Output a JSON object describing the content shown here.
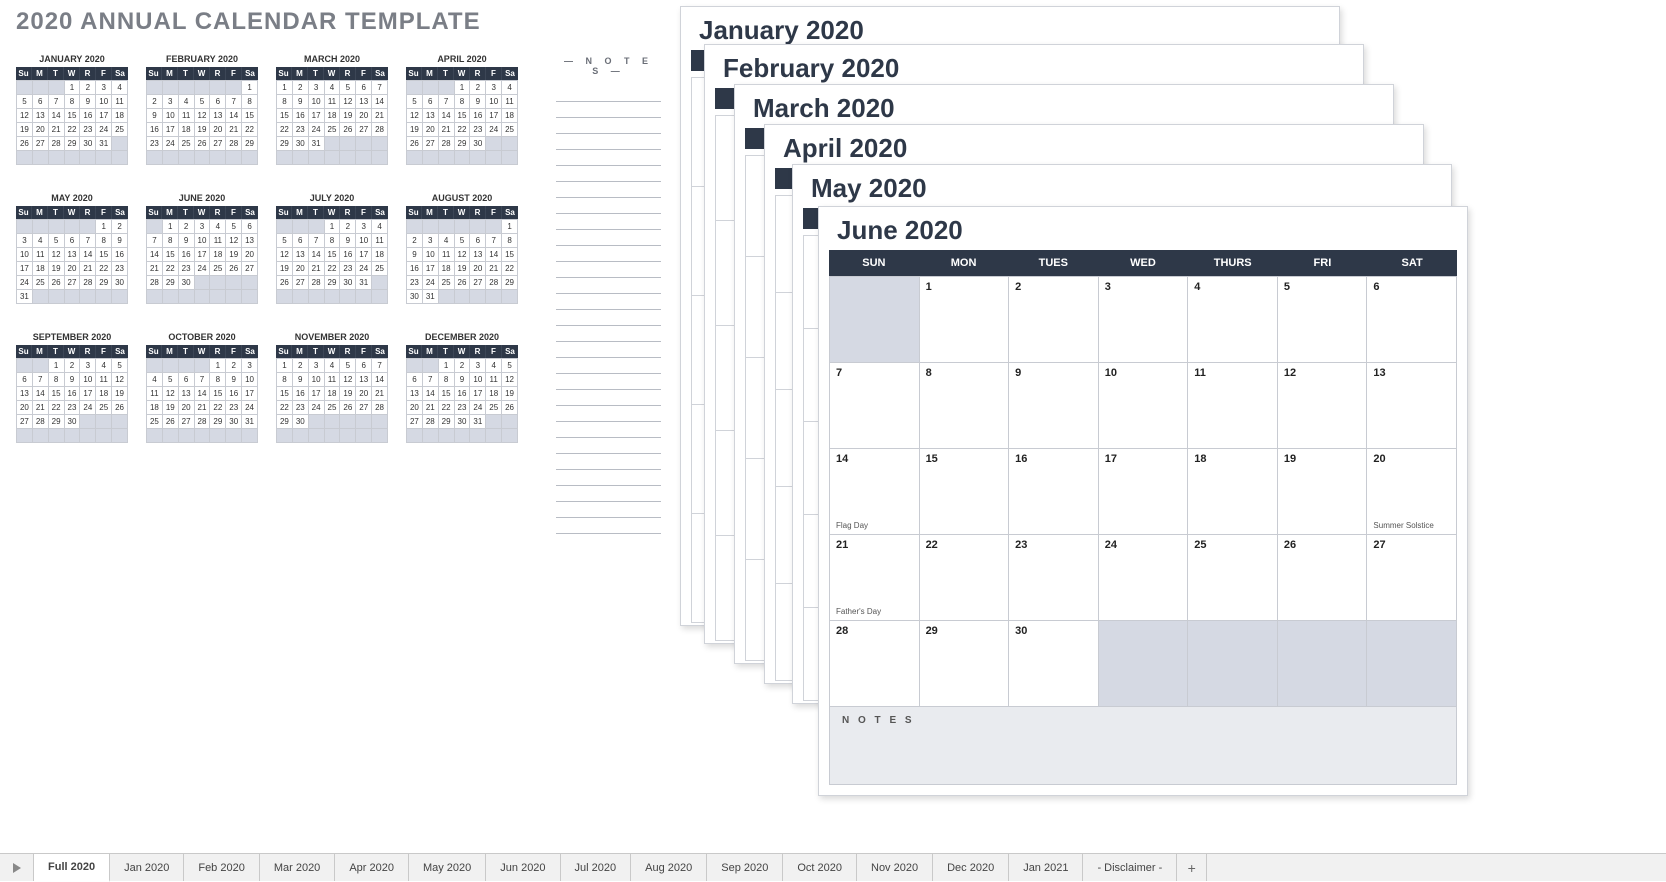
{
  "title": "2020 ANNUAL CALENDAR TEMPLATE",
  "notesLabel": "— N O T E S —",
  "dayShort": [
    "Su",
    "M",
    "T",
    "W",
    "R",
    "F",
    "Sa"
  ],
  "dayLong": [
    "SUN",
    "MON",
    "TUES",
    "WED",
    "THURS",
    "FRI",
    "SAT"
  ],
  "miniMonths": [
    {
      "name": "JANUARY 2020",
      "start": 3,
      "days": 31
    },
    {
      "name": "FEBRUARY 2020",
      "start": 6,
      "days": 29
    },
    {
      "name": "MARCH 2020",
      "start": 0,
      "days": 31
    },
    {
      "name": "APRIL 2020",
      "start": 3,
      "days": 30
    },
    {
      "name": "MAY 2020",
      "start": 5,
      "days": 31
    },
    {
      "name": "JUNE 2020",
      "start": 1,
      "days": 30
    },
    {
      "name": "JULY 2020",
      "start": 3,
      "days": 31
    },
    {
      "name": "AUGUST 2020",
      "start": 6,
      "days": 31
    },
    {
      "name": "SEPTEMBER 2020",
      "start": 2,
      "days": 30
    },
    {
      "name": "OCTOBER 2020",
      "start": 4,
      "days": 31
    },
    {
      "name": "NOVEMBER 2020",
      "start": 0,
      "days": 30
    },
    {
      "name": "DECEMBER 2020",
      "start": 2,
      "days": 31
    }
  ],
  "stackTitles": [
    "January 2020",
    "February 2020",
    "March 2020",
    "April 2020",
    "May 2020"
  ],
  "front": {
    "title": "June 2020",
    "start": 1,
    "days": 30,
    "events": {
      "14": "Flag Day",
      "20": "Summer Solstice",
      "21": "Father's Day"
    },
    "notesLabel": "N O T E S"
  },
  "tabs": [
    "Full 2020",
    "Jan 2020",
    "Feb 2020",
    "Mar 2020",
    "Apr 2020",
    "May 2020",
    "Jun 2020",
    "Jul 2020",
    "Aug 2020",
    "Sep 2020",
    "Oct 2020",
    "Nov 2020",
    "Dec 2020",
    "Jan 2021",
    "- Disclaimer -"
  ],
  "activeTab": 0
}
